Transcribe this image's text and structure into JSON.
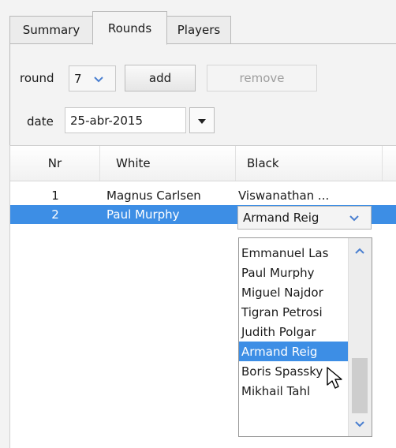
{
  "tabs": [
    {
      "label": "Summary"
    },
    {
      "label": "Rounds"
    },
    {
      "label": "Players"
    }
  ],
  "round": {
    "label": "round",
    "value": "7",
    "add_label": "add",
    "remove_label": "remove"
  },
  "date": {
    "label": "date",
    "value": "25-abr-2015"
  },
  "table": {
    "columns": [
      "Nr",
      "White",
      "Black"
    ],
    "rows": [
      {
        "nr": "1",
        "white": "Magnus Carlsen",
        "black": "Viswanathan ..."
      },
      {
        "nr": "2",
        "white": "Paul Murphy",
        "black": "Armand Reig"
      }
    ]
  },
  "black_dropdown": {
    "options": [
      "Emmanuel Las",
      "Paul Murphy",
      "Miguel Najdor",
      "Tigran Petrosi",
      "Judith Polgar",
      "Armand Reig",
      "Boris Spassky",
      "Mikhail Tahl"
    ],
    "selected_index": 5
  },
  "colors": {
    "selection": "#3d8ee5",
    "tab_border": "#b9b9b9"
  },
  "icons": [
    "chevron-down-icon",
    "calendar-dropdown-icon",
    "scroll-up-icon",
    "scroll-down-icon",
    "mouse-pointer-icon"
  ]
}
